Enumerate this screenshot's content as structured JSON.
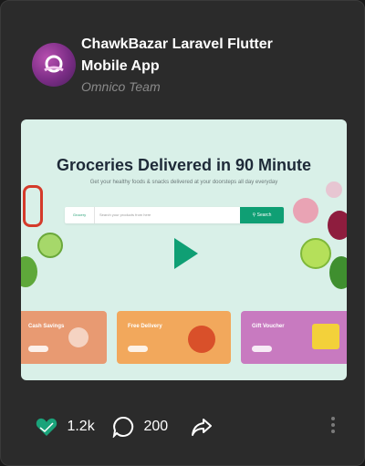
{
  "card": {
    "title": "ChawkBazar Laravel Flutter Mobile App",
    "author": "Omnico Team"
  },
  "preview": {
    "hero_title": "Groceries Delivered in 90 Minute",
    "hero_subtitle": "Get your healthy foods & snacks delivered at your doorsteps all day everyday",
    "search_category": "Grocery",
    "search_placeholder": "Search your products from here",
    "search_button": "Search",
    "promos": [
      "Cash Savings",
      "Free Delivery",
      "Gift Voucher"
    ],
    "play_icon": "play-icon"
  },
  "actions": {
    "likes": "1.2k",
    "comments": "200",
    "like_icon": "heart-icon",
    "comment_icon": "comment-icon",
    "share_icon": "share-icon",
    "more_icon": "more-vertical-icon"
  },
  "colors": {
    "accent": "#0f9f74",
    "card_bg": "#2b2b2b"
  }
}
